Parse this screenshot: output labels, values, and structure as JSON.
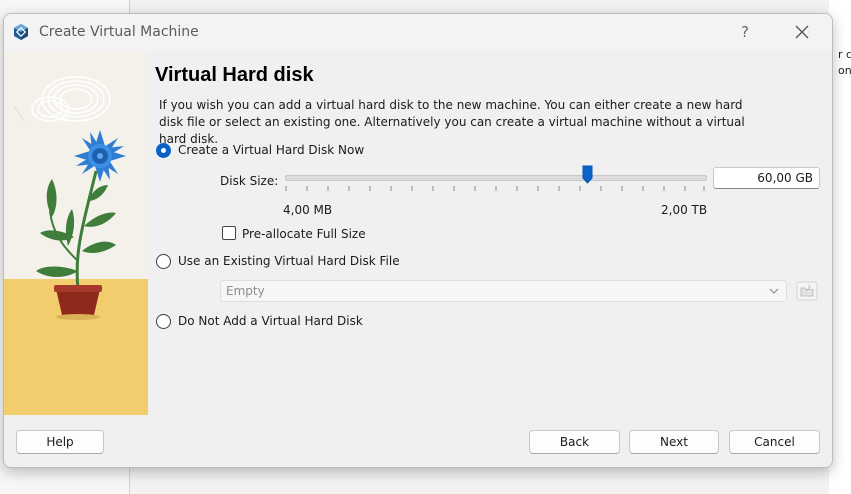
{
  "background": {
    "right_text_lines": [
      "r co",
      "ond"
    ]
  },
  "window": {
    "title": "Create Virtual Machine",
    "help_label": "?",
    "close_icon": "close-icon",
    "app_icon": "virtualbox-icon"
  },
  "page": {
    "heading": "Virtual Hard disk",
    "description": "If you wish you can add a virtual hard disk to the new machine. You can either create a new hard disk file or select an existing one. Alternatively you can create a virtual machine without a virtual hard disk."
  },
  "options": {
    "create_new": {
      "label": "Create a Virtual Hard Disk Now",
      "selected": true
    },
    "use_existing": {
      "label": "Use an Existing Virtual Hard Disk File",
      "selected": false
    },
    "none": {
      "label": "Do Not Add a Virtual Hard Disk",
      "selected": false
    }
  },
  "disk_size": {
    "label": "Disk Size:",
    "value": "60,00 GB",
    "min_label": "4,00 MB",
    "max_label": "2,00 TB",
    "slider_fraction": 0.72
  },
  "preallocate": {
    "label": "Pre-allocate Full Size",
    "checked": false
  },
  "existing_file": {
    "selected": "Empty",
    "folder_icon": "folder-open-icon"
  },
  "footer": {
    "help": "Help",
    "back": "Back",
    "next": "Next",
    "cancel": "Cancel"
  },
  "colors": {
    "accent": "#0a63c7",
    "sand": "#f2cd6e",
    "flower": "#2f7dd3",
    "pot": "#8e2a1c",
    "leaf": "#3f7d3b"
  }
}
